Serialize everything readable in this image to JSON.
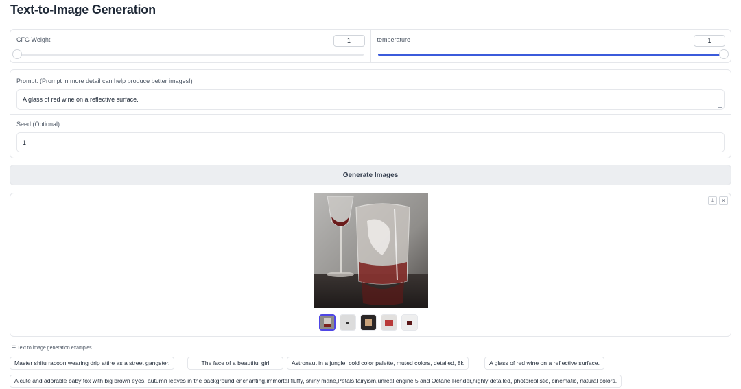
{
  "page": {
    "title": "Text-to-Image Generation"
  },
  "controls": {
    "cfg": {
      "label": "CFG Weight",
      "value": "1",
      "fraction": 0.0
    },
    "temperature": {
      "label": "temperature",
      "value": "1",
      "fraction": 1.0
    }
  },
  "prompt": {
    "label": "Prompt. (Prompt in more detail can help produce better images!)",
    "value": "A glass of red wine on a reflective surface."
  },
  "seed": {
    "label": "Seed (Optional)",
    "value": "1"
  },
  "generate_button": "Generate Images",
  "gallery": {
    "selected_index": 0,
    "thumbnail_count": 5,
    "icons": [
      "download-icon",
      "close-icon"
    ]
  },
  "examples": {
    "label": "Text to image generation examples.",
    "items": [
      "Master shifu racoon wearing drip attire as a street gangster.",
      "The face of a beautiful girl",
      "Astronaut in a jungle, cold color palette, muted colors, detailed, 8k",
      "A glass of red wine on a reflective surface.",
      "A cute and adorable baby fox with big brown eyes, autumn leaves in the background enchanting,immortal,fluffy, shiny mane,Petals,fairyism,unreal engine 5 and Octane Render,highly detailed, photorealistic, cinematic, natural colors."
    ]
  },
  "colors": {
    "accent": "#3b5bdb",
    "selected_border": "#4f46e5",
    "button_bg": "#eceef1"
  }
}
